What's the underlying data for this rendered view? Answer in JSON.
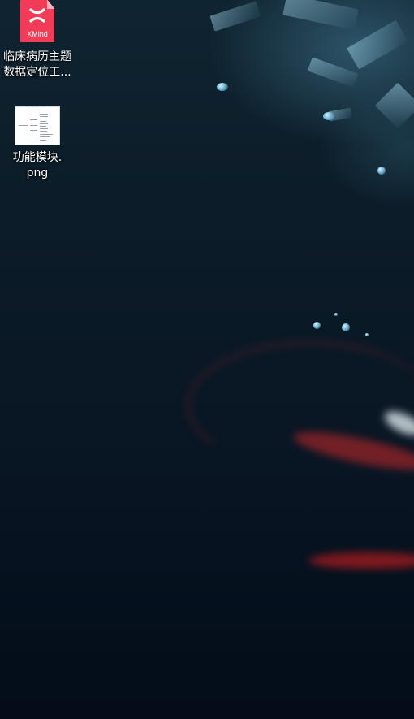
{
  "desktop": {
    "icons": [
      {
        "label": "临床病历主题\n数据定位工...",
        "type": "XMind",
        "badge_text": "XMind",
        "icon_name": "xmind-file-icon",
        "accent": "#f23b57"
      },
      {
        "label": "功能模块.\npng",
        "type": "png",
        "icon_name": "png-image-thumbnail-icon"
      }
    ]
  }
}
